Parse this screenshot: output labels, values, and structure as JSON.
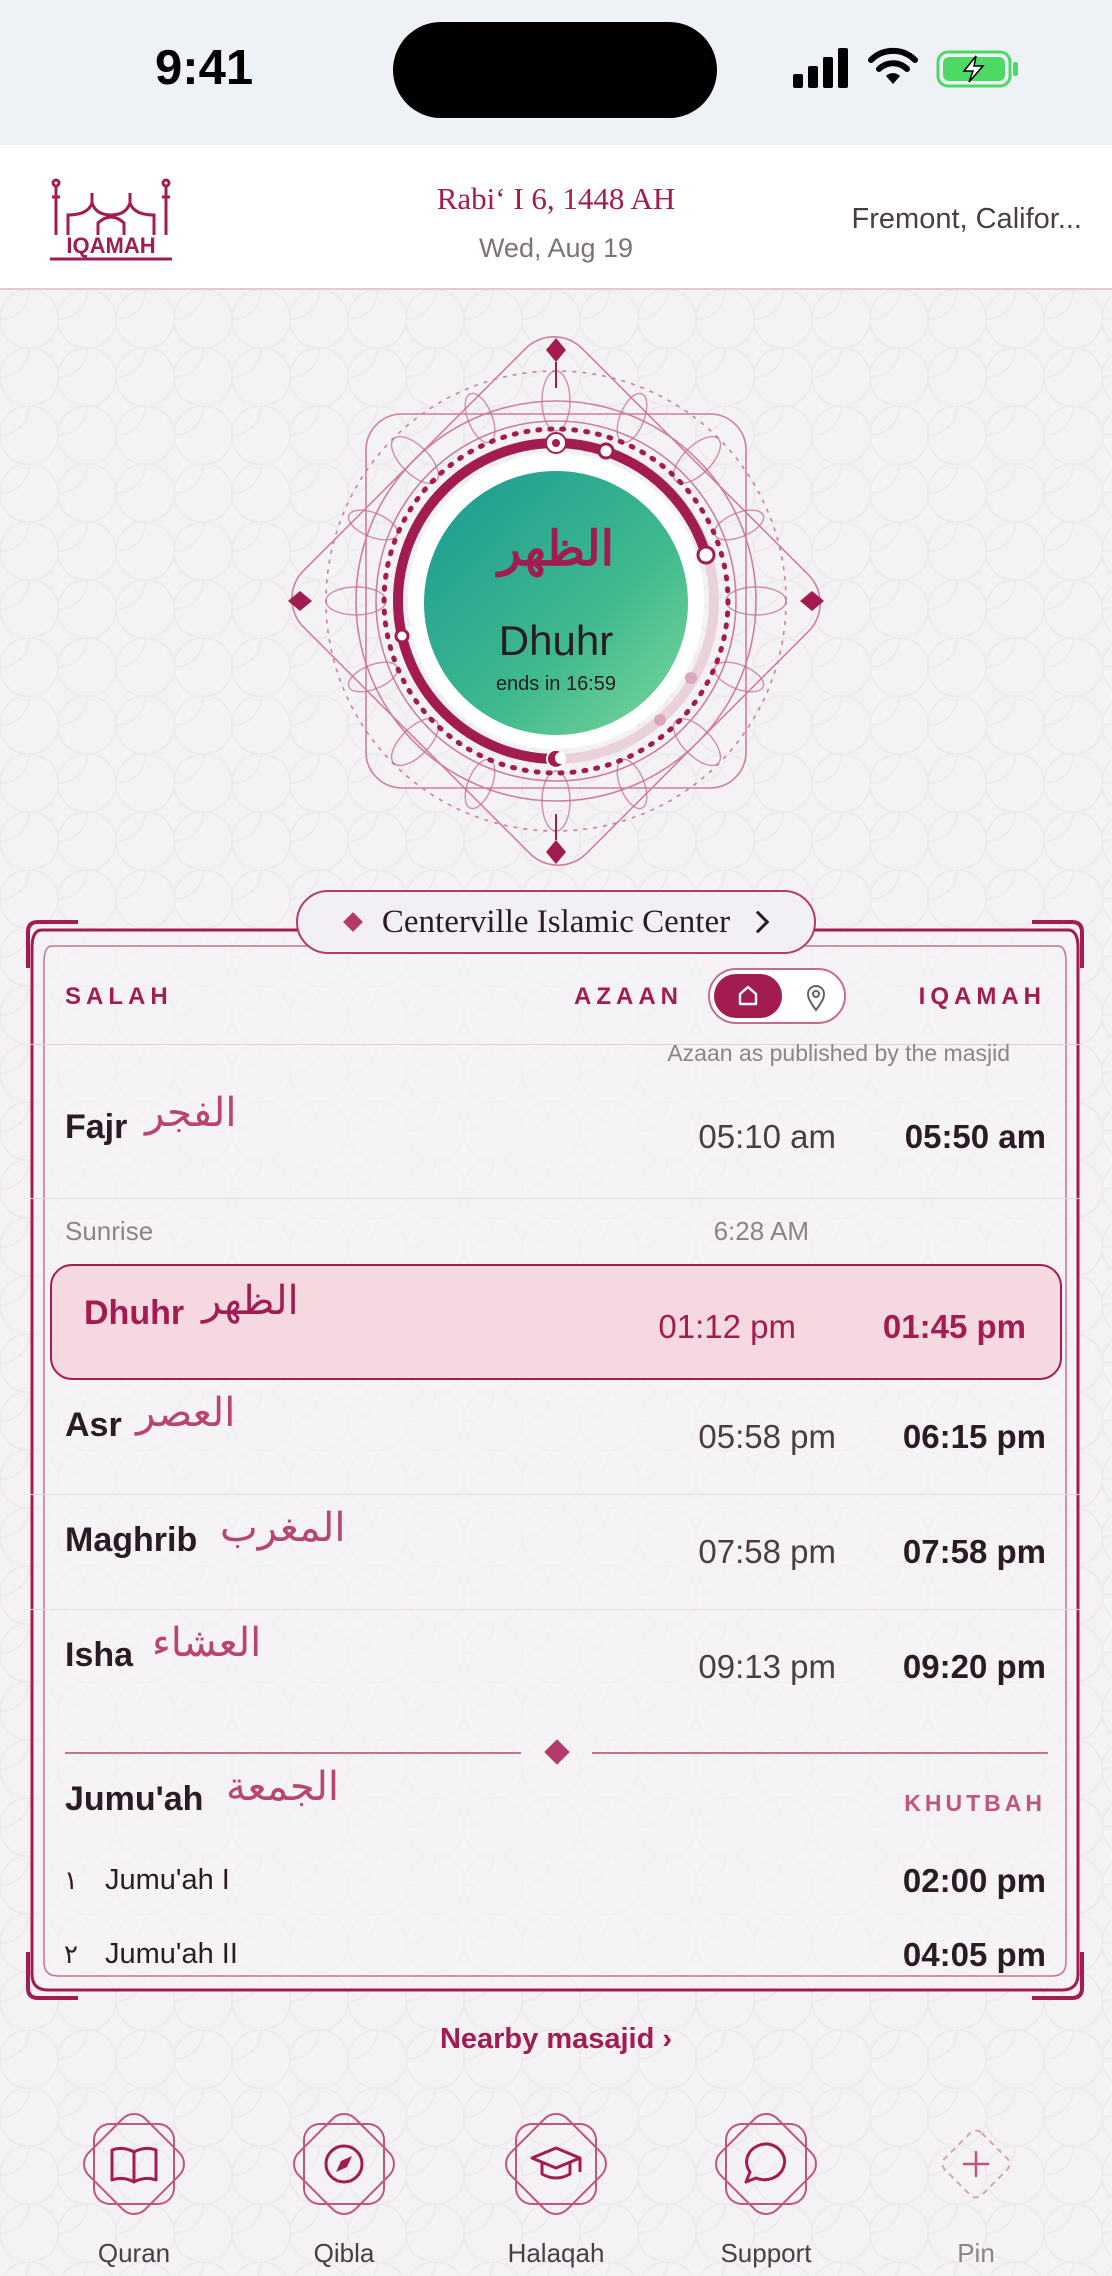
{
  "status": {
    "time": "9:41"
  },
  "header": {
    "logo_text": "IQAMAH",
    "hijri_date": "Rabiʻ I 6, 1448 AH",
    "gregorian_date": "Wed, Aug 19",
    "location": "Fremont, Califor..."
  },
  "current_prayer": {
    "arabic": "الظهر",
    "name": "Dhuhr",
    "ends": "ends in 16:59"
  },
  "masjid": {
    "name": "Centerville Islamic Center"
  },
  "table": {
    "col_salah": "SALAH",
    "col_azaan": "AZAAN",
    "col_iqamah": "IQAMAH",
    "note": "Azaan as published by the masjid",
    "prayers": [
      {
        "name": "Fajr",
        "arabic": "الفجر",
        "azaan": "05:10 am",
        "iqamah": "05:50 am"
      },
      {
        "name": "Dhuhr",
        "arabic": "الظهر",
        "azaan": "01:12 pm",
        "iqamah": "01:45 pm",
        "active": true
      },
      {
        "name": "Asr",
        "arabic": "العصر",
        "azaan": "05:58 pm",
        "iqamah": "06:15 pm"
      },
      {
        "name": "Maghrib",
        "arabic": "المغرب",
        "azaan": "07:58 pm",
        "iqamah": "07:58 pm"
      },
      {
        "name": "Isha",
        "arabic": "العشاء",
        "azaan": "09:13 pm",
        "iqamah": "09:20 pm"
      }
    ],
    "sunrise_label": "Sunrise",
    "sunrise_time": "6:28 AM"
  },
  "jumuah": {
    "title": "Jumu'ah",
    "arabic": "الجمعة",
    "khutbah_label": "KHUTBAH",
    "items": [
      {
        "num": "١",
        "name": "Jumu'ah I",
        "time": "02:00 pm"
      },
      {
        "num": "٢",
        "name": "Jumu'ah II",
        "time": "04:05 pm"
      }
    ]
  },
  "nearby_link": "Nearby masajid ›",
  "dock": [
    {
      "label": "Quran",
      "icon": "book-icon"
    },
    {
      "label": "Qibla",
      "icon": "compass-icon"
    },
    {
      "label": "Halaqah",
      "icon": "graduation-cap-icon"
    },
    {
      "label": "Support",
      "icon": "chat-bubble-icon"
    },
    {
      "label": "Pin",
      "icon": "plus-icon"
    }
  ],
  "colors": {
    "accent": "#a21c52",
    "active_bg": "#f5d8e0",
    "hero_gradient_start": "#7ed89a",
    "hero_gradient_end": "#1a9a93"
  }
}
